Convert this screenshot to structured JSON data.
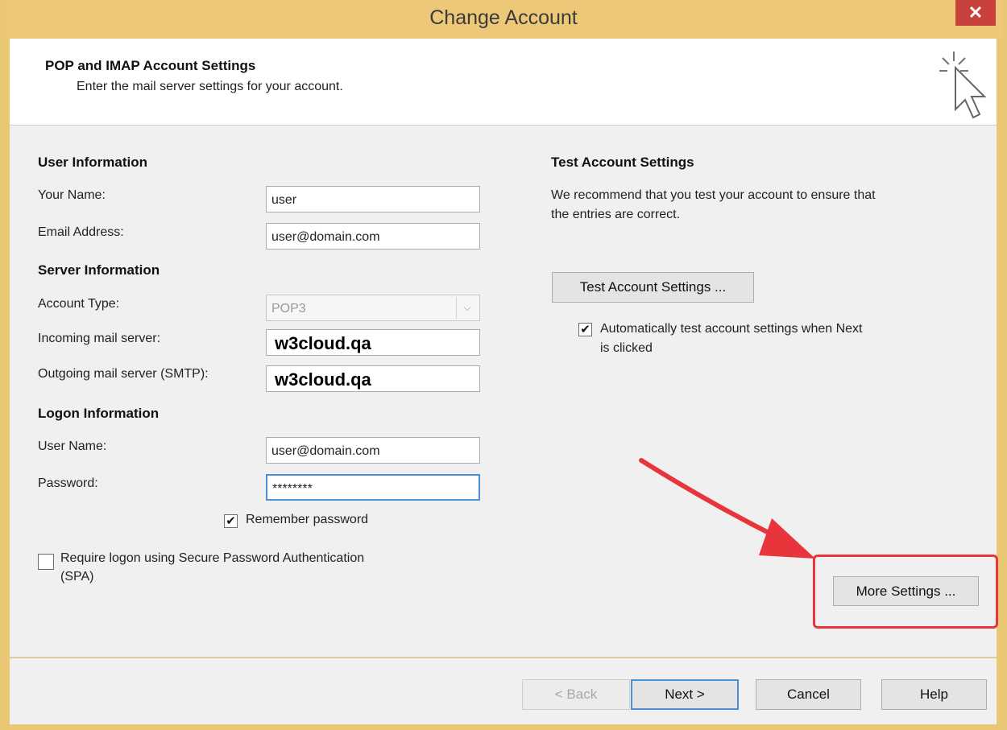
{
  "window": {
    "title": "Change Account",
    "close_glyph": "✕"
  },
  "header": {
    "title": "POP and IMAP Account Settings",
    "subtitle": "Enter the mail server settings for your account.",
    "icon": "cursor-click-icon"
  },
  "user_info": {
    "heading": "User Information",
    "name_label": "Your Name:",
    "name_value": "user",
    "email_label": "Email Address:",
    "email_value": "user@domain.com"
  },
  "server_info": {
    "heading": "Server Information",
    "account_type_label": "Account Type:",
    "account_type_value": "POP3",
    "incoming_label": "Incoming mail server:",
    "incoming_value": "w3cloud.qa",
    "outgoing_label": "Outgoing mail server (SMTP):",
    "outgoing_value": "w3cloud.qa"
  },
  "logon_info": {
    "heading": "Logon Information",
    "username_label": "User Name:",
    "username_value": "user@domain.com",
    "password_label": "Password:",
    "password_value": "********",
    "remember_label": "Remember password",
    "remember_checked": true,
    "spa_label_line1": "Require logon using Secure Password Authentication",
    "spa_label_line2": "(SPA)",
    "spa_checked": false
  },
  "test_settings": {
    "heading": "Test Account Settings",
    "description_line1": "We recommend that you test your account to ensure that",
    "description_line2": "the entries are correct.",
    "test_button": "Test Account Settings ...",
    "auto_test_line1": "Automatically test account settings when Next",
    "auto_test_line2": "is clicked",
    "auto_test_checked": true
  },
  "more_settings_button": "More Settings ...",
  "footer": {
    "back": "< Back",
    "next": "Next >",
    "cancel": "Cancel",
    "help": "Help"
  },
  "colors": {
    "titlebar": "#edc878",
    "close": "#c8413a",
    "annotation": "#e8353b",
    "focus": "#4a90d9"
  },
  "check_glyph": "✔",
  "combo_glyph": "⌵"
}
